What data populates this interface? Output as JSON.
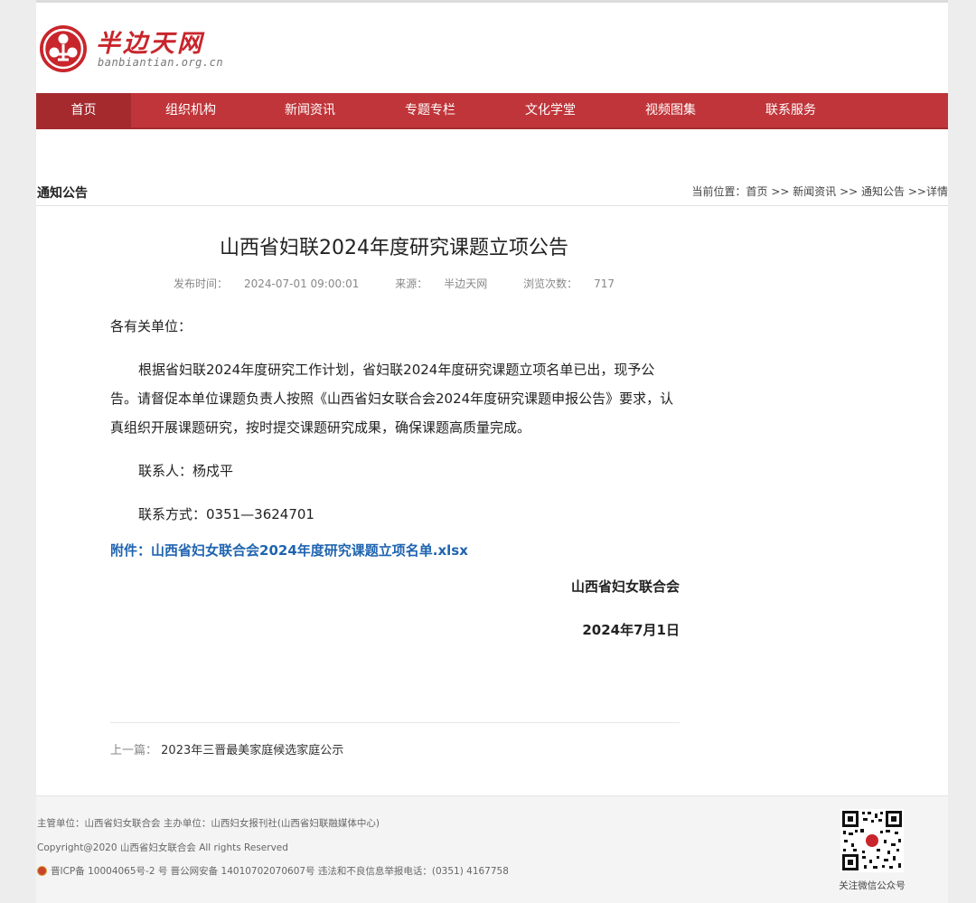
{
  "site": {
    "name": "半边天网",
    "domain": "banbiantian.org.cn",
    "brand_color": "#c8262c"
  },
  "nav": {
    "items": [
      {
        "label": "首页",
        "active": true
      },
      {
        "label": "组织机构"
      },
      {
        "label": "新闻资讯"
      },
      {
        "label": "专题专栏"
      },
      {
        "label": "文化学堂"
      },
      {
        "label": "视频图集"
      },
      {
        "label": "联系服务"
      }
    ],
    "color": "#c0353a"
  },
  "section": {
    "title": "通知公告",
    "breadcrumb_prefix": "当前位置：",
    "breadcrumb": [
      "首页",
      "新闻资讯",
      "通知公告",
      "详情"
    ]
  },
  "article": {
    "title": "山西省妇联2024年度研究课题立项公告",
    "publish_label": "发布时间：",
    "publish_time": "2024-07-01 09:00:01",
    "source_label": "来源：",
    "source": "半边天网",
    "views_label": "浏览次数：",
    "views": "717",
    "greeting": "各有关单位：",
    "paragraph": "根据省妇联2024年度研究工作计划，省妇联2024年度研究课题立项名单已出，现予公告。请督促本单位课题负责人按照《山西省妇女联合会2024年度研究课题申报公告》要求，认真组织开展课题研究，按时提交课题研究成果，确保课题高质量完成。",
    "contact": "联系人：杨戍平",
    "phone": "联系方式：0351—3624701",
    "attachment_label": "附件：",
    "attachment": "山西省妇女联合会2024年度研究课题立项名单.xlsx",
    "signature": "山西省妇女联合会",
    "date": "2024年7月1日",
    "prev_label": "上一篇：",
    "prev_title": "2023年三晋最美家庭候选家庭公示"
  },
  "footer": {
    "line1": "主管单位：山西省妇女联合会 主办单位：山西妇女报刊社(山西省妇联融媒体中心)",
    "line2": "Copyright@2020 山西省妇女联合会 All rights Reserved",
    "line3": "晋ICP备 10004065号-2 号 晋公网安备 14010702070607号    违法和不良信息举报电话：(0351) 4167758",
    "qr_label": "关注微信公众号"
  }
}
